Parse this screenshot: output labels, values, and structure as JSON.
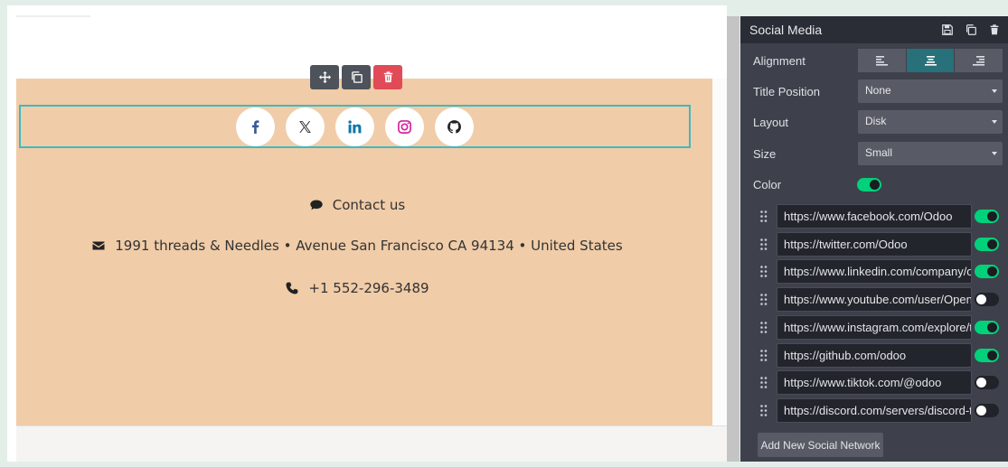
{
  "icons": {
    "move": "move-icon",
    "duplicate": "duplicate-icon",
    "delete": "trash-icon",
    "facebook": "facebook-icon",
    "x": "x-twitter-icon",
    "linkedin": "linkedin-icon",
    "instagram": "instagram-icon",
    "github": "github-icon",
    "chat": "chat-bubble-icon",
    "envelope": "envelope-icon",
    "phone": "phone-icon",
    "save": "save-icon",
    "copy": "copy-icon",
    "trash": "trash-icon",
    "drag": "drag-handle-icon"
  },
  "colors": {
    "footer_bg": "#f0cca8",
    "selection_border": "#3fb9c1",
    "delete_button": "#e04b57",
    "toggle_on": "#00d17a",
    "panel_bg": "#3e414b",
    "align_active": "#28707a",
    "facebook": "#3b5998",
    "linkedin": "#0e76a8",
    "instagram": "#d6249f"
  },
  "footer": {
    "contact": "Contact us",
    "address": "1991 threads & Needles • Avenue San Francisco CA 94134 • United States",
    "phone": "+1 552-296-3489"
  },
  "panel": {
    "title": "Social Media",
    "alignment_label": "Alignment",
    "alignment_selected": "center",
    "title_position_label": "Title Position",
    "title_position_value": "None",
    "layout_label": "Layout",
    "layout_value": "Disk",
    "size_label": "Size",
    "size_value": "Small",
    "color_label": "Color",
    "color_enabled": true,
    "links": [
      {
        "url": "https://www.facebook.com/Odoo",
        "enabled": true
      },
      {
        "url": "https://twitter.com/Odoo",
        "enabled": true
      },
      {
        "url": "https://www.linkedin.com/company/odoo",
        "enabled": true
      },
      {
        "url": "https://www.youtube.com/user/OpenERPonline",
        "enabled": false
      },
      {
        "url": "https://www.instagram.com/explore/tags/odoo/",
        "enabled": true
      },
      {
        "url": "https://github.com/odoo",
        "enabled": true
      },
      {
        "url": "https://www.tiktok.com/@odoo",
        "enabled": false
      },
      {
        "url": "https://discord.com/servers/discord-town-hall",
        "enabled": false
      }
    ],
    "add_button": "Add New Social Network"
  }
}
